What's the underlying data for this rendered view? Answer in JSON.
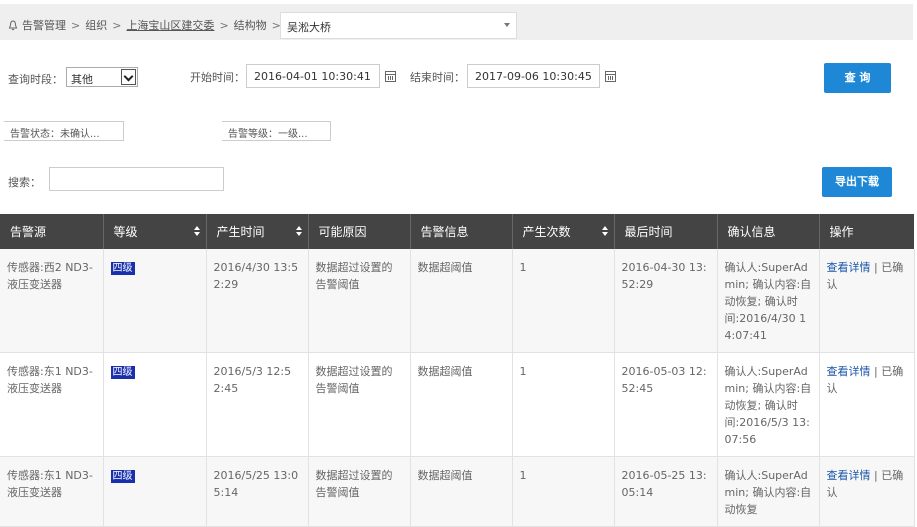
{
  "breadcrumb": {
    "items": [
      "告警管理",
      "组织",
      "上海宝山区建交委",
      "结构物"
    ],
    "selected": "吴淞大桥"
  },
  "filters": {
    "period_label": "查询时段：",
    "period_value": "其他",
    "start_label": "开始时间：",
    "start_value": "2016-04-01 10:30:41",
    "end_label": "结束时间：",
    "end_value": "2017-09-06 10:30:45",
    "query_button": "查 询",
    "status_dropdown": "告警状态：未确认...",
    "level_dropdown": "告警等级：一级...",
    "search_label": "搜索：",
    "search_value": "",
    "export_button": "导出下载"
  },
  "table": {
    "headers": [
      "告警源",
      "等级",
      "产生时间",
      "可能原因",
      "告警信息",
      "产生次数",
      "最后时间",
      "确认信息",
      "操作"
    ],
    "rows": [
      {
        "source": "传感器:西2 ND3-液压变送器",
        "level": "四级",
        "time": "2016/4/30 13:52:29",
        "reason": "数据超过设置的告警阈值",
        "info": "数据超阈值",
        "count": "1",
        "last": "2016-04-30 13:52:29",
        "confirm": "确认人:SuperAdmin; 确认内容:自动恢复; 确认时间:2016/4/30 14:07:41",
        "op_link": "查看详情",
        "op_sep": " | ",
        "op_status": "已确认"
      },
      {
        "source": "传感器:东1 ND3-液压变送器",
        "level": "四级",
        "time": "2016/5/3 12:52:45",
        "reason": "数据超过设置的告警阈值",
        "info": "数据超阈值",
        "count": "1",
        "last": "2016-05-03 12:52:45",
        "confirm": "确认人:SuperAdmin; 确认内容:自动恢复; 确认时间:2016/5/3 13:07:56",
        "op_link": "查看详情",
        "op_sep": " | ",
        "op_status": "已确认"
      },
      {
        "source": "传感器:东1 ND3-液压变送器",
        "level": "四级",
        "time": "2016/5/25 13:05:14",
        "reason": "数据超过设置的告警阈值",
        "info": "数据超阈值",
        "count": "1",
        "last": "2016-05-25 13:05:14",
        "confirm": "确认人:SuperAdmin; 确认内容:自动恢复",
        "op_link": "查看详情",
        "op_sep": " | ",
        "op_status": "已确认"
      }
    ]
  },
  "colors": {
    "accent": "#1e88d6",
    "header_bg": "#444444",
    "badge": "#1a2fae",
    "link": "#1a56a8"
  }
}
